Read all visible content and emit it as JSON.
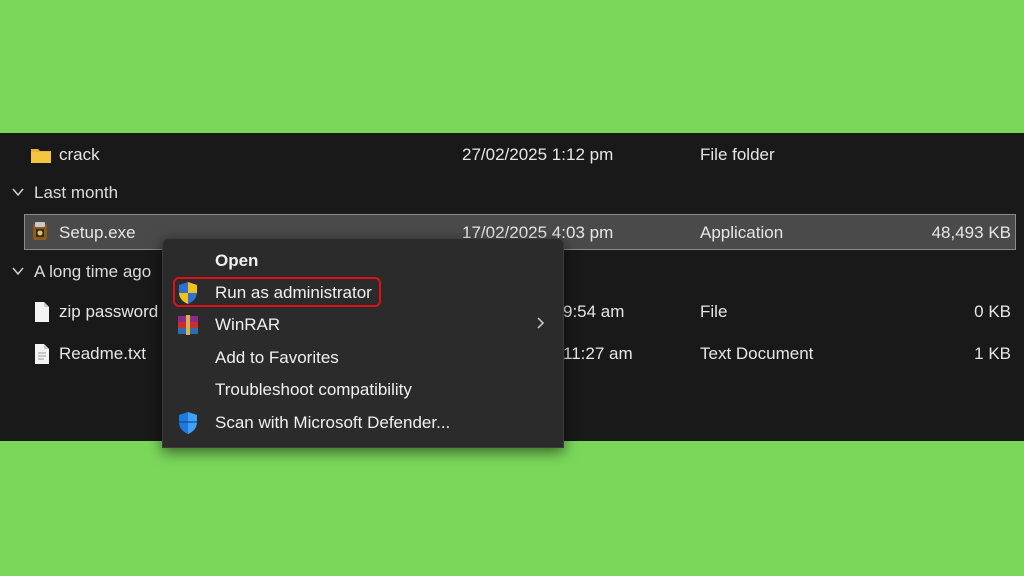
{
  "files": {
    "top": {
      "name": "crack",
      "date": "27/02/2025 1:12 pm",
      "type": "File folder",
      "size": "",
      "icon": "folder-icon"
    },
    "groups": [
      {
        "label": "Last month",
        "icon": "chevron-down-icon"
      },
      {
        "label": "A long time ago",
        "icon": "chevron-down-icon"
      }
    ],
    "selected": {
      "name": "Setup.exe",
      "date": "17/02/2025 4:03 pm",
      "type": "Application",
      "size": "48,493 KB",
      "icon": "installer-icon"
    },
    "old": [
      {
        "name": "zip password",
        "date": "9:54 am",
        "type": "File",
        "size": "0 KB",
        "icon": "file-icon"
      },
      {
        "name": "Readme.txt",
        "date": "11:27 am",
        "type": "Text Document",
        "size": "1 KB",
        "icon": "text-file-icon"
      }
    ]
  },
  "context_menu": {
    "items": [
      {
        "label": "Open",
        "bold": true
      },
      {
        "label": "Run as administrator",
        "icon": "uac-shield-icon",
        "highlighted": true
      },
      {
        "label": "WinRAR",
        "icon": "winrar-icon",
        "submenu": true
      },
      {
        "label": "Add to Favorites"
      },
      {
        "label": "Troubleshoot compatibility"
      },
      {
        "label": "Scan with Microsoft Defender...",
        "icon": "defender-shield-icon"
      }
    ]
  },
  "colors": {
    "background": "#7ad75a",
    "explorer_bg": "#191919",
    "menu_bg": "#2b2b2b",
    "highlight_border": "#e0101a",
    "folder": "#f5c542"
  }
}
